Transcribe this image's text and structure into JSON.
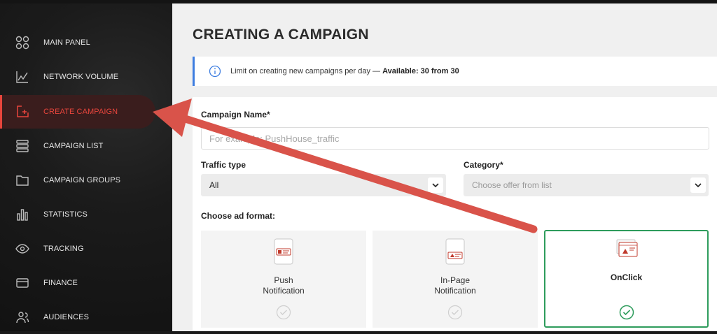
{
  "sidebar": {
    "items": [
      {
        "label": "MAIN PANEL",
        "icon": "grid-icon"
      },
      {
        "label": "NETWORK VOLUME",
        "icon": "chart-line-icon"
      },
      {
        "label": "CREATE CAMPAIGN",
        "icon": "plus-square-icon",
        "active": true
      },
      {
        "label": "CAMPAIGN LIST",
        "icon": "list-icon"
      },
      {
        "label": "CAMPAIGN GROUPS",
        "icon": "folder-icon"
      },
      {
        "label": "STATISTICS",
        "icon": "bar-chart-icon"
      },
      {
        "label": "TRACKING",
        "icon": "eye-icon"
      },
      {
        "label": "FINANCE",
        "icon": "card-icon"
      },
      {
        "label": "AUDIENCES",
        "icon": "users-icon"
      }
    ]
  },
  "page": {
    "title": "CREATING A CAMPAIGN"
  },
  "info": {
    "text": "Limit on creating new campaigns per day —",
    "available": "Available: 30 from 30"
  },
  "form": {
    "name_label": "Campaign Name*",
    "name_placeholder": "For example: PushHouse_traffic",
    "traffic_label": "Traffic type",
    "traffic_value": "All",
    "category_label": "Category*",
    "category_placeholder": "Choose offer from list",
    "format_label": "Choose ad format:",
    "formats": [
      {
        "line1": "Push",
        "line2": "Notification",
        "selected": false
      },
      {
        "line1": "In-Page",
        "line2": "Notification",
        "selected": false
      },
      {
        "line1": "OnClick",
        "line2": "",
        "selected": true
      }
    ]
  },
  "colors": {
    "accent": "#e8453c",
    "arrow": "#d9534a",
    "info_border": "#3d7de0",
    "selected_border": "#2e9c5c"
  }
}
